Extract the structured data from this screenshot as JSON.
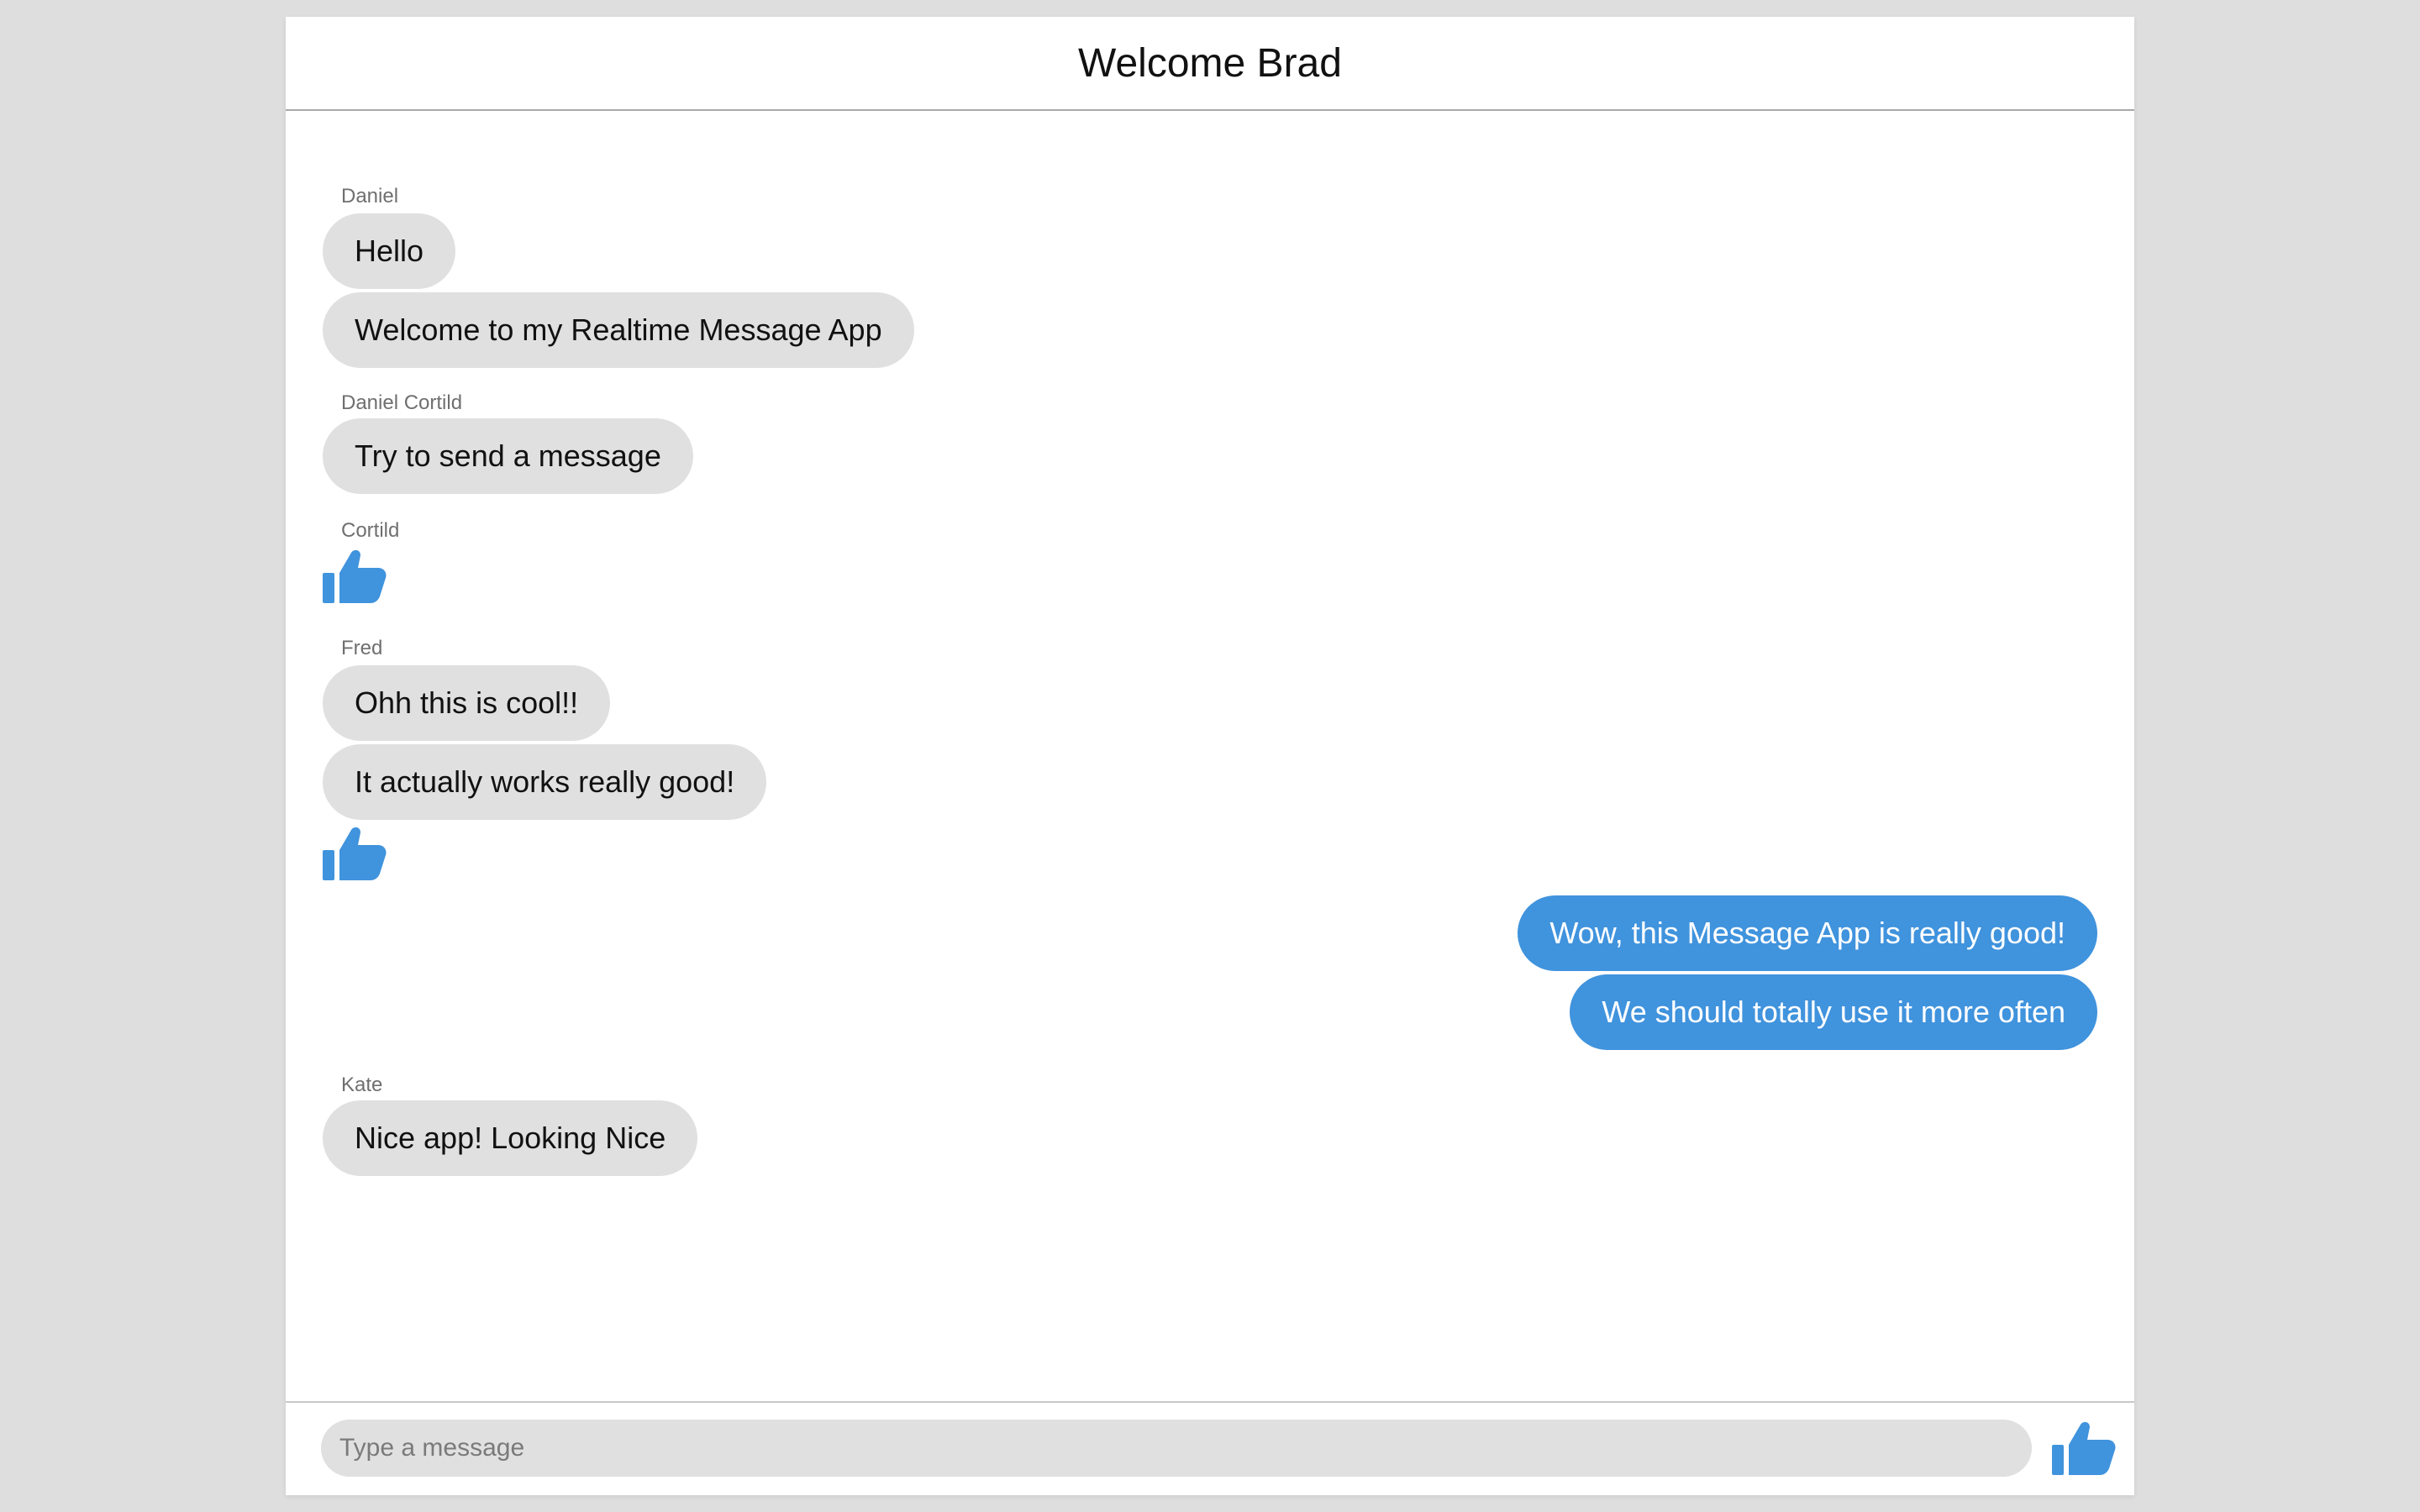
{
  "header": {
    "title": "Welcome Brad"
  },
  "colors": {
    "accent": "#4093dd",
    "bubble_incoming": "#e0e0e0",
    "page_background": "#dedede"
  },
  "messages": [
    {
      "sender": "Daniel",
      "items": [
        "Hello",
        "Welcome to my Realtime Message App"
      ]
    },
    {
      "sender": "Daniel Cortild",
      "items": [
        "Try to send a message"
      ]
    },
    {
      "sender": "Cortild",
      "items": [
        "thumbs-up-icon"
      ]
    },
    {
      "sender": "Fred",
      "items": [
        "Ohh this is cool!!",
        "It actually works really good!",
        "thumbs-up-icon"
      ]
    },
    {
      "sender": "",
      "items": [
        "Wow, this Message App is really good!",
        "We should totally use it more often"
      ]
    },
    {
      "sender": "Kate",
      "items": [
        "Nice app! Looking Nice"
      ]
    }
  ],
  "composer": {
    "placeholder": "Type a message",
    "value": "",
    "send_icon": "thumbs-up-icon"
  }
}
